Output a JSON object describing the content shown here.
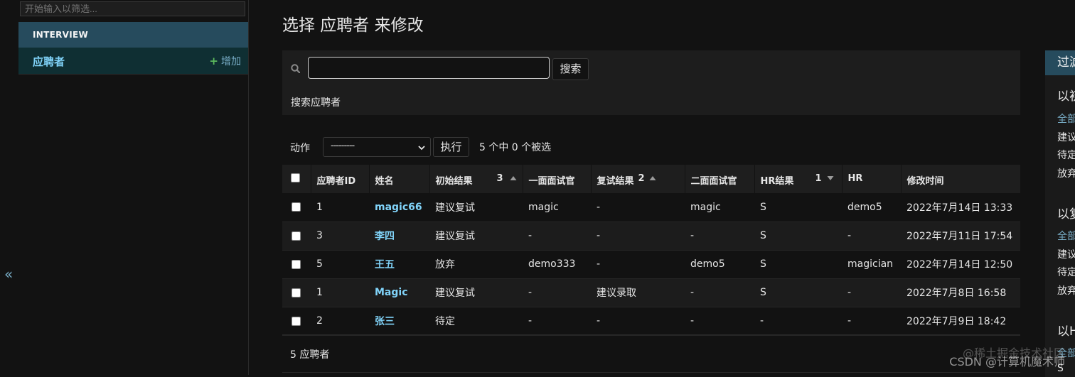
{
  "nav": {
    "collapse_glyph": "«",
    "filter_placeholder": "开始输入以筛选...",
    "app_caption": "INTERVIEW",
    "model_name": "应聘者",
    "add_label": "增加",
    "add_glyph": "+"
  },
  "main": {
    "title": "选择 应聘者 来修改",
    "search": {
      "value": "",
      "button_label": "搜索",
      "help_text": "搜索应聘者"
    },
    "actions": {
      "label": "动作",
      "selected_option": "---------",
      "run_label": "执行",
      "counter": "5 个中 0 个被选"
    },
    "table": {
      "columns": [
        {
          "label": "应聘者ID"
        },
        {
          "label": "姓名"
        },
        {
          "label": "初始结果",
          "sort_priority": "3",
          "sort_dir": "asc"
        },
        {
          "label": "一面面试官"
        },
        {
          "label": "复试结果",
          "sort_priority": "2",
          "sort_dir": "asc"
        },
        {
          "label": "二面面试官"
        },
        {
          "label": "HR结果",
          "sort_priority": "1",
          "sort_dir": "desc"
        },
        {
          "label": "HR"
        },
        {
          "label": "修改时间"
        }
      ],
      "rows": [
        {
          "id": "1",
          "name": "magic66",
          "first_result": "建议复试",
          "first_interviewer": "magic",
          "second_result": "-",
          "second_interviewer": "magic",
          "hr_result": "S",
          "hr": "demo5",
          "modified": "2022年7月14日 13:33"
        },
        {
          "id": "3",
          "name": "李四",
          "first_result": "建议复试",
          "first_interviewer": "-",
          "second_result": "-",
          "second_interviewer": "-",
          "hr_result": "S",
          "hr": "-",
          "modified": "2022年7月11日 17:54"
        },
        {
          "id": "5",
          "name": "王五",
          "first_result": "放弃",
          "first_interviewer": "demo333",
          "second_result": "-",
          "second_interviewer": "demo5",
          "hr_result": "S",
          "hr": "magician",
          "modified": "2022年7月14日 12:50"
        },
        {
          "id": "1",
          "name": "Magic",
          "first_result": "建议复试",
          "first_interviewer": "-",
          "second_result": "建议录取",
          "second_interviewer": "-",
          "hr_result": "S",
          "hr": "-",
          "modified": "2022年7月8日 16:58"
        },
        {
          "id": "2",
          "name": "张三",
          "first_result": "待定",
          "first_interviewer": "-",
          "second_result": "-",
          "second_interviewer": "-",
          "hr_result": "-",
          "hr": "-",
          "modified": "2022年7月9日 18:42"
        }
      ]
    },
    "paginator": "5 应聘者"
  },
  "filter": {
    "title": "过滤",
    "heading1": "以初",
    "options1": [
      "全部",
      "建议",
      "待定",
      "放弃"
    ],
    "heading2": "以复",
    "options2": [
      "全部",
      "建议",
      "待定",
      "放弃"
    ],
    "heading3": "以H",
    "options3": [
      "全部",
      "S"
    ]
  },
  "watermark": {
    "line1": "@稀土掘金技术社区",
    "line2": "CSDN @计算机魔术师"
  },
  "colors": {
    "accent": "#264b5d",
    "link": "#81d4fa",
    "background": "#121212",
    "add_plus": "#5bb85d"
  }
}
